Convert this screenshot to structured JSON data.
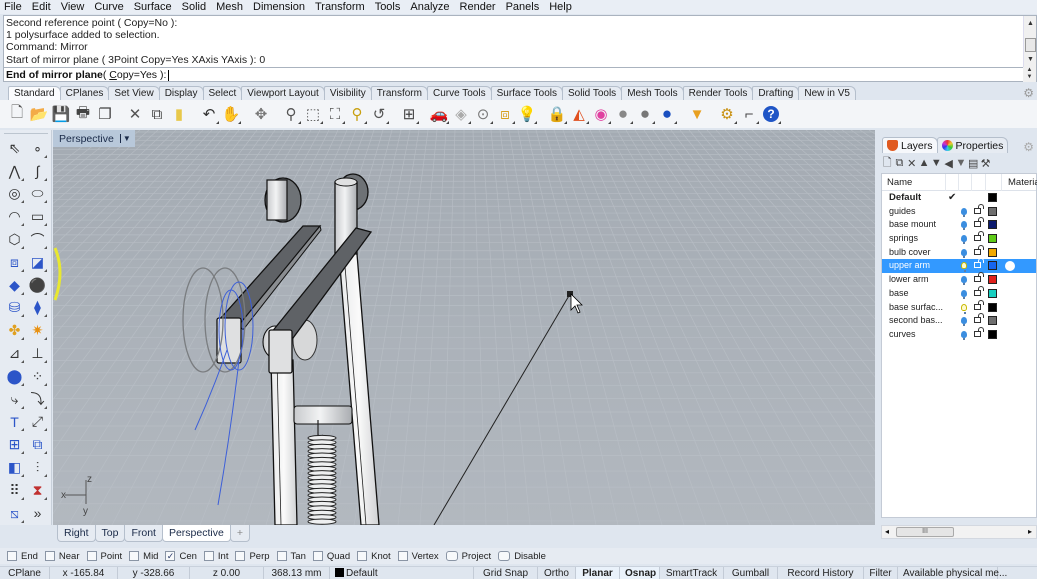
{
  "menu": [
    "File",
    "Edit",
    "View",
    "Curve",
    "Surface",
    "Solid",
    "Mesh",
    "Dimension",
    "Transform",
    "Tools",
    "Analyze",
    "Render",
    "Panels",
    "Help"
  ],
  "command": {
    "history": [
      "Second reference point ( Copy=No ):",
      "1 polysurface added to selection.",
      "Command: Mirror",
      "Start of mirror plane ( 3Point  Copy=Yes  XAxis  YAxis ): 0"
    ],
    "prompt_bold": "End of mirror plane",
    "prompt_rest": " ( Copy=Yes ): ",
    "input_value": ""
  },
  "toolbar_tabs": [
    "Standard",
    "CPlanes",
    "Set View",
    "Display",
    "Select",
    "Viewport Layout",
    "Visibility",
    "Transform",
    "Curve Tools",
    "Surface Tools",
    "Solid Tools",
    "Mesh Tools",
    "Render Tools",
    "Drafting",
    "New in V5"
  ],
  "toolbar_active_tab": "Standard",
  "standard_icons": [
    {
      "name": "new-file-icon",
      "glyph": "🗋",
      "color": "#555"
    },
    {
      "name": "open-folder-icon",
      "glyph": "📂",
      "color": "#d59a1a"
    },
    {
      "name": "save-icon",
      "glyph": "💾",
      "color": "#4a6a2a"
    },
    {
      "name": "print-icon",
      "glyph": "🖶",
      "color": "#444"
    },
    {
      "name": "import-icon",
      "glyph": "❐",
      "color": "#444"
    },
    {
      "name": "cut-icon",
      "glyph": "✕",
      "color": "#555"
    },
    {
      "name": "copy-icon",
      "glyph": "⧉",
      "color": "#444"
    },
    {
      "name": "paste-icon",
      "glyph": "▮",
      "color": "#e8c84a"
    },
    {
      "name": "undo-icon",
      "glyph": "↶",
      "color": "#333"
    },
    {
      "name": "pan-hand-icon",
      "glyph": "✋",
      "color": "#555"
    },
    {
      "name": "rotate-view-icon",
      "glyph": "✥",
      "color": "#777"
    },
    {
      "name": "zoom-dynamic-icon",
      "glyph": "⚲",
      "color": "#555"
    },
    {
      "name": "zoom-window-icon",
      "glyph": "⬚",
      "color": "#555"
    },
    {
      "name": "zoom-extents-icon",
      "glyph": "⛶",
      "color": "#555"
    },
    {
      "name": "zoom-selected-icon",
      "glyph": "⚲",
      "color": "#c8a010"
    },
    {
      "name": "undo-view-icon",
      "glyph": "↺",
      "color": "#555"
    },
    {
      "name": "four-viewports-icon",
      "glyph": "⊞",
      "color": "#444"
    },
    {
      "name": "car-render-icon",
      "glyph": "🚗",
      "color": "#d22"
    },
    {
      "name": "hide-objects-icon",
      "glyph": "◈",
      "color": "#aaa"
    },
    {
      "name": "select-icon",
      "glyph": "⊙",
      "color": "#777"
    },
    {
      "name": "group-icon",
      "glyph": "⧈",
      "color": "#d8a020"
    },
    {
      "name": "lightbulb-icon",
      "glyph": "💡",
      "color": "#888"
    },
    {
      "name": "lock-icon",
      "glyph": "🔒",
      "color": "#555"
    },
    {
      "name": "layer-icon",
      "glyph": "◭",
      "color": "#e05020"
    },
    {
      "name": "color-wheel-icon",
      "glyph": "◉",
      "color": "#e040a0"
    },
    {
      "name": "shaded-sphere-icon",
      "glyph": "●",
      "color": "#888"
    },
    {
      "name": "rendered-sphere-icon",
      "glyph": "●",
      "color": "#777"
    },
    {
      "name": "blue-sphere-icon",
      "glyph": "●",
      "color": "#1a4fc0"
    },
    {
      "name": "light-cone-icon",
      "glyph": "▼",
      "color": "#e8a020"
    },
    {
      "name": "options-gear-icon",
      "glyph": "⚙",
      "color": "#c89010"
    },
    {
      "name": "dimension-icon",
      "glyph": "⌐",
      "color": "#444"
    },
    {
      "name": "help-icon",
      "glyph": "?",
      "color": "#fff"
    }
  ],
  "left_tools": [
    "select-arrow-icon",
    "point-icon",
    "polyline-icon",
    "curve-icon",
    "circle-icon",
    "ellipse-icon",
    "arc-icon",
    "rectangle-icon",
    "polygon-icon",
    "fillet-curve-icon",
    "surface-corner-icon",
    "surface-edge-icon",
    "box-icon",
    "sphere-icon",
    "cylinder-icon",
    "cage-edit-icon",
    "boolean-icon",
    "explode-icon",
    "trim-icon",
    "split-icon",
    "group-icon",
    "points-on-icon",
    "fillet-icon",
    "offset-icon",
    "text-icon",
    "scale-icon",
    "array-icon",
    "align-icon",
    "solid-box-icon",
    "grid-points-icon",
    "rectangular-array-icon",
    "bounding-box-icon",
    "analyze-icon",
    "more-icon"
  ],
  "viewport": {
    "title": "Perspective",
    "axes": {
      "x": "x",
      "y": "y",
      "z": "z"
    }
  },
  "viewport_tabs": [
    "Right",
    "Top",
    "Front",
    "Perspective",
    "+"
  ],
  "viewport_active_tab": "Perspective",
  "panel": {
    "tabs": [
      "Layers",
      "Properties"
    ],
    "active_tab": "Layers",
    "tool_icons": [
      "new-layer-icon",
      "new-sublayer-icon",
      "delete-icon",
      "move-up-icon",
      "move-down-icon",
      "move-parent-icon",
      "filter-icon",
      "clipboard-icon",
      "tools-icon"
    ],
    "columns": [
      "Name",
      "Material"
    ],
    "layers": [
      {
        "name": "Default",
        "current": true,
        "visible": null,
        "locked": false,
        "color": "#000000",
        "bold": true
      },
      {
        "name": "guides",
        "visible": true,
        "color": "#6f6f6f"
      },
      {
        "name": "base mount",
        "visible": true,
        "color": "#0c1a6e"
      },
      {
        "name": "springs",
        "visible": true,
        "color": "#5ecb17"
      },
      {
        "name": "bulb cover",
        "visible": true,
        "color": "#f2a900"
      },
      {
        "name": "upper arm",
        "visible": "off",
        "color": "#1565f0",
        "selected": true,
        "material": true
      },
      {
        "name": "lower arm",
        "visible": true,
        "color": "#e0201c"
      },
      {
        "name": "base",
        "visible": true,
        "color": "#18cfc0"
      },
      {
        "name": "base surfac...",
        "visible": "off",
        "color": "#000000"
      },
      {
        "name": "second bas...",
        "visible": true,
        "color": "#6f6f6f"
      },
      {
        "name": "curves",
        "visible": true,
        "color": "#000000"
      }
    ],
    "scroll_thumb": "III"
  },
  "osnap": [
    {
      "label": "End",
      "checked": false
    },
    {
      "label": "Near",
      "checked": false
    },
    {
      "label": "Point",
      "checked": false
    },
    {
      "label": "Mid",
      "checked": false
    },
    {
      "label": "Cen",
      "checked": true
    },
    {
      "label": "Int",
      "checked": false
    },
    {
      "label": "Perp",
      "checked": false
    },
    {
      "label": "Tan",
      "checked": false
    },
    {
      "label": "Quad",
      "checked": false
    },
    {
      "label": "Knot",
      "checked": false
    },
    {
      "label": "Vertex",
      "checked": false
    },
    {
      "label": "Project",
      "checked": false,
      "round": true
    },
    {
      "label": "Disable",
      "checked": false,
      "round": true
    }
  ],
  "status": {
    "cplane": "CPlane",
    "x": "x -165.84",
    "y": "y -328.66",
    "z": "z 0.00",
    "distance": "368.13 mm",
    "layer": "Default",
    "toggles": [
      {
        "label": "Grid Snap",
        "bold": false
      },
      {
        "label": "Ortho",
        "bold": false
      },
      {
        "label": "Planar",
        "bold": true
      },
      {
        "label": "Osnap",
        "bold": true
      },
      {
        "label": "SmartTrack",
        "bold": false
      },
      {
        "label": "Gumball",
        "bold": false
      },
      {
        "label": "Record History",
        "bold": false
      },
      {
        "label": "Filter",
        "bold": false
      }
    ],
    "message": "Available physical me..."
  }
}
